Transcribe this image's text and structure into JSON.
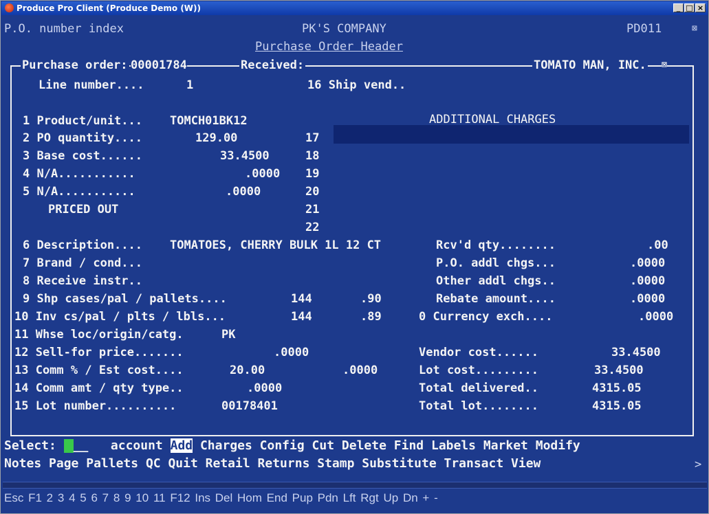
{
  "window": {
    "title": "Produce Pro Client (Produce Demo (W))",
    "min_glyph": "_",
    "max_glyph": "□",
    "close_glyph": "×"
  },
  "header": {
    "screen_name": "P.O. number index",
    "company": "PK'S COMPANY",
    "program_code": "PD011",
    "screen_title": "Purchase Order Header",
    "corner_glyph": "⊠"
  },
  "po": {
    "label": "Purchase order:",
    "number": "00001784",
    "received_label": "Received:",
    "vendor": "TOMATO MAN, INC.",
    "box_glyph": "⊠"
  },
  "fields": {
    "line_number_label": "Line number....",
    "line_number": "1",
    "ship_vend_label": "16 Ship vend..",
    "product_label": "1 Product/unit...",
    "product": "TOMCH01BK12",
    "po_qty_label": "2 PO quantity....",
    "po_qty": "129.00",
    "base_cost_label": "3 Base cost......",
    "base_cost": "33.4500",
    "na4_label": "4 N/A...........",
    "na4": ".0000",
    "na5_label": "5 N/A...........",
    "na5": ".0000",
    "priced_out": "PRICED OUT",
    "description_label": "6 Description....",
    "description": "TOMATOES, CHERRY BULK 1L 12 CT",
    "brand_label": "7 Brand / cond...",
    "receive_instr_label": "8 Receive instr..",
    "shp_label": "9 Shp cases/pal / pallets....",
    "shp_cases": "144",
    "shp_pallets": ".90",
    "inv_label": "10 Inv cs/pal / plts / lbls...",
    "inv_cases": "144",
    "inv_pallets": ".89",
    "whse_label": "11 Whse loc/origin/catg.",
    "whse": "PK",
    "sell_label": "12 Sell-for price.......",
    "sell": ".0000",
    "comm_label": "13 Comm % / Est cost....",
    "comm_pct": "20.00",
    "est_cost": ".0000",
    "comm_amt_label": "14 Comm amt / qty type..",
    "comm_amt": ".0000",
    "lot_label": "15 Lot number..........",
    "lot": "00178401"
  },
  "charges": {
    "title": "ADDITIONAL CHARGES",
    "lines": [
      "17",
      "18",
      "19",
      "20",
      "21",
      "22"
    ]
  },
  "totals": {
    "rcvd_label": "Rcv'd qty........",
    "rcvd": ".00",
    "po_addl_label": "P.O. addl chgs...",
    "po_addl": ".0000",
    "other_addl_label": "Other addl chgs..",
    "other_addl": ".0000",
    "rebate_label": "Rebate amount....",
    "rebate": ".0000",
    "currency_label": "0 Currency exch....",
    "currency": ".0000",
    "vendor_cost_label": "Vendor cost......",
    "vendor_cost": "33.4500",
    "lot_cost_label": "Lot cost.........",
    "lot_cost": "33.4500",
    "total_delivered_label": "Total delivered..",
    "total_delivered": "4315.05",
    "total_lot_label": "Total lot........",
    "total_lot": "4315.05"
  },
  "menu": {
    "select_label": "Select:",
    "cursor_tail": "__",
    "account": "account",
    "row1": [
      "Add",
      "Charges",
      "Config",
      "Cut",
      "Delete",
      "Find",
      "Labels",
      "Market",
      "Modify"
    ],
    "row2": [
      "Notes",
      "Page",
      "Pallets",
      "QC",
      "Quit",
      "Retail",
      "Returns",
      "Stamp",
      "Substitute",
      "Transact",
      "View"
    ],
    "more_glyph": ">"
  },
  "fkeys": {
    "items": [
      "Esc",
      "F1",
      "2",
      "3",
      "4",
      "5",
      "6",
      "7",
      "8",
      "9",
      "10",
      "11",
      "F12",
      "Ins",
      "Del",
      "Hom",
      "End",
      "Pup",
      "Pdn",
      "Lft",
      "Rgt",
      "Up",
      "Dn",
      "+",
      "-"
    ]
  },
  "colors": {
    "background": "#1d3a8c",
    "band": "#0f2570",
    "cursor": "#39c84a"
  }
}
